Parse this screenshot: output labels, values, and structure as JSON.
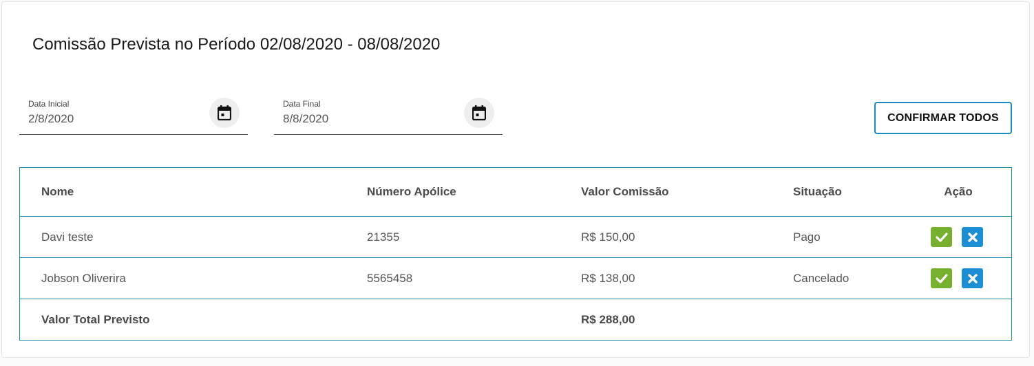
{
  "page": {
    "title": "Comissão Prevista no Período 02/08/2020 - 08/08/2020"
  },
  "filters": {
    "start": {
      "label": "Data Inicial",
      "value": "2/8/2020",
      "icon": "calendar-icon"
    },
    "end": {
      "label": "Data Final",
      "value": "8/8/2020",
      "icon": "calendar-icon"
    },
    "confirm_all_label": "CONFIRMAR TODOS"
  },
  "table": {
    "columns": [
      "Nome",
      "Número Apólice",
      "Valor Comissão",
      "Situação",
      "Ação"
    ],
    "rows": [
      {
        "nome": "Davi teste",
        "apolice": "21355",
        "valor": "R$ 150,00",
        "situacao": "Pago"
      },
      {
        "nome": "Jobson Oliverira",
        "apolice": "5565458",
        "valor": "R$ 138,00",
        "situacao": "Cancelado"
      }
    ],
    "total": {
      "label": "Valor Total Previsto",
      "valor": "R$ 288,00"
    }
  },
  "colors": {
    "accent": "#1a8fa8",
    "button_border": "#1a8bc0",
    "confirm_green": "#77b02e",
    "cancel_blue": "#1c8fd4"
  },
  "icons": {
    "confirm": "check-icon",
    "cancel": "close-icon"
  }
}
